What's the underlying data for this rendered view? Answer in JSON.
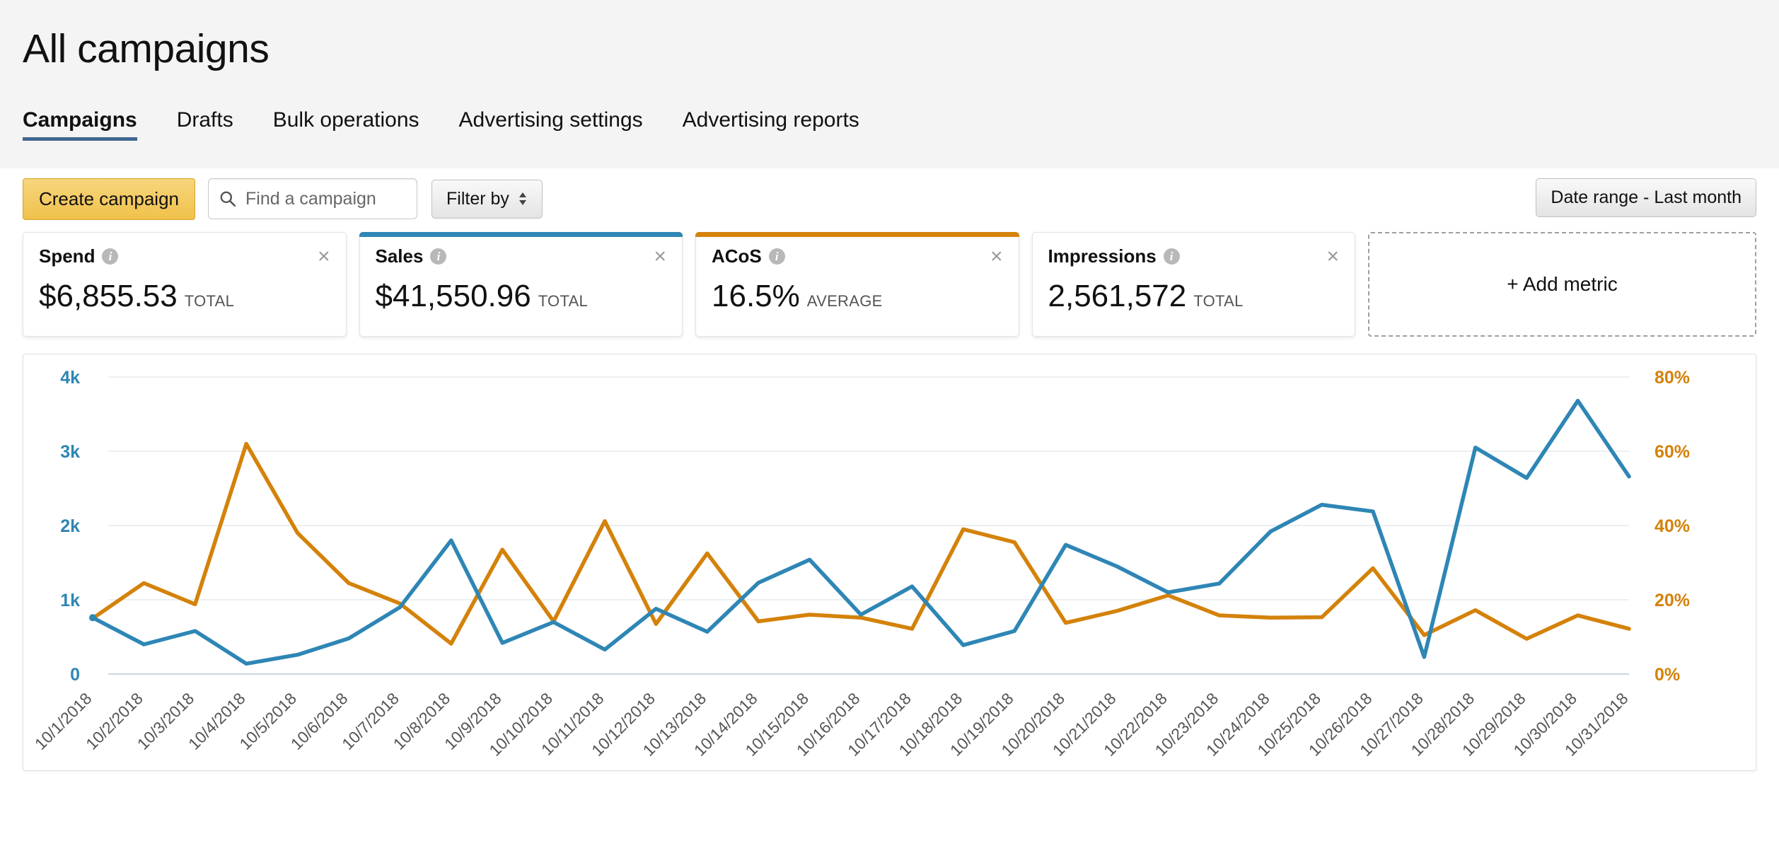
{
  "header": {
    "title": "All campaigns",
    "tabs": [
      {
        "label": "Campaigns",
        "active": true
      },
      {
        "label": "Drafts",
        "active": false
      },
      {
        "label": "Bulk operations",
        "active": false
      },
      {
        "label": "Advertising settings",
        "active": false
      },
      {
        "label": "Advertising reports",
        "active": false
      }
    ]
  },
  "toolbar": {
    "create_label": "Create campaign",
    "search_placeholder": "Find a campaign",
    "search_value": "",
    "search_icon": "search-icon",
    "filter_label": "Filter by",
    "date_range_label": "Date range - Last month"
  },
  "metrics": {
    "cards": [
      {
        "label": "Spend",
        "value": "$6,855.53",
        "unit": "TOTAL",
        "accent": "none",
        "accent_color": "transparent"
      },
      {
        "label": "Sales",
        "value": "$41,550.96",
        "unit": "TOTAL",
        "accent": "blue",
        "accent_color": "#2e86b5"
      },
      {
        "label": "ACoS",
        "value": "16.5%",
        "unit": "AVERAGE",
        "accent": "orange",
        "accent_color": "#d4820a"
      },
      {
        "label": "Impressions",
        "value": "2,561,572",
        "unit": "TOTAL",
        "accent": "none",
        "accent_color": "transparent"
      }
    ],
    "close_glyph": "×",
    "info_glyph": "i",
    "add_metric_label": "+ Add metric"
  },
  "chart_data": {
    "type": "line",
    "title": "",
    "xlabel": "",
    "grid": true,
    "legend": "none",
    "categories": [
      "10/1/2018",
      "10/2/2018",
      "10/3/2018",
      "10/4/2018",
      "10/5/2018",
      "10/6/2018",
      "10/7/2018",
      "10/8/2018",
      "10/9/2018",
      "10/10/2018",
      "10/11/2018",
      "10/12/2018",
      "10/13/2018",
      "10/14/2018",
      "10/15/2018",
      "10/16/2018",
      "10/17/2018",
      "10/18/2018",
      "10/19/2018",
      "10/20/2018",
      "10/21/2018",
      "10/22/2018",
      "10/23/2018",
      "10/24/2018",
      "10/25/2018",
      "10/26/2018",
      "10/27/2018",
      "10/28/2018",
      "10/29/2018",
      "10/30/2018",
      "10/31/2018"
    ],
    "series": [
      {
        "name": "Sales",
        "color": "#2e86b5",
        "axis": "left",
        "ylabel": "Sales",
        "ylim": [
          0,
          4000
        ],
        "yticks": [
          0,
          1000,
          2000,
          3000,
          4000
        ],
        "ytick_labels": [
          "0",
          "1k",
          "2k",
          "3k",
          "4k"
        ],
        "values": [
          760,
          400,
          580,
          140,
          260,
          480,
          900,
          1800,
          420,
          700,
          330,
          880,
          570,
          1230,
          1540,
          800,
          1180,
          390,
          580,
          1740,
          1450,
          1100,
          1220,
          1920,
          2280,
          2190,
          230,
          3050,
          2640,
          3680,
          2660
        ]
      },
      {
        "name": "ACoS",
        "color": "#d4820a",
        "axis": "right",
        "ylabel": "ACoS",
        "ylim": [
          0,
          0.8
        ],
        "yticks": [
          0,
          0.2,
          0.4,
          0.6,
          0.8
        ],
        "ytick_labels": [
          "0%",
          "20%",
          "40%",
          "60%",
          "80%"
        ],
        "values": [
          0.15,
          0.245,
          0.188,
          0.62,
          0.38,
          0.245,
          0.19,
          0.082,
          0.335,
          0.142,
          0.412,
          0.135,
          0.325,
          0.142,
          0.16,
          0.152,
          0.122,
          0.39,
          0.355,
          0.138,
          0.17,
          0.212,
          0.158,
          0.152,
          0.153,
          0.285,
          0.105,
          0.172,
          0.095,
          0.158,
          0.122
        ]
      }
    ]
  }
}
